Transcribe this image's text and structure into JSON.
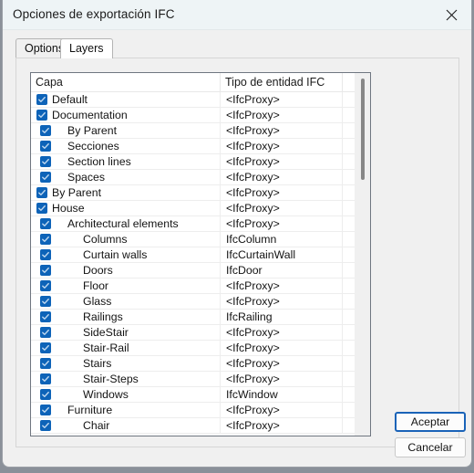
{
  "window": {
    "title": "Opciones de exportación IFC",
    "close_icon": "close-icon"
  },
  "tabs": [
    {
      "id": "options",
      "label": "Options",
      "active": false
    },
    {
      "id": "layers",
      "label": "Layers",
      "active": true
    }
  ],
  "grid": {
    "columns": [
      "Capa",
      "Tipo de entidad IFC",
      ""
    ],
    "rows": [
      {
        "name": "Default",
        "type": "<IfcProxy>",
        "level": 0,
        "checked": true
      },
      {
        "name": "Documentation",
        "type": "<IfcProxy>",
        "level": 0,
        "checked": true
      },
      {
        "name": "By Parent",
        "type": "<IfcProxy>",
        "level": 1,
        "checked": true
      },
      {
        "name": "Secciones",
        "type": "<IfcProxy>",
        "level": 1,
        "checked": true
      },
      {
        "name": "Section lines",
        "type": "<IfcProxy>",
        "level": 1,
        "checked": true
      },
      {
        "name": "Spaces",
        "type": "<IfcProxy>",
        "level": 1,
        "checked": true
      },
      {
        "name": "By Parent",
        "type": "<IfcProxy>",
        "level": 0,
        "checked": true
      },
      {
        "name": "House",
        "type": "<IfcProxy>",
        "level": 0,
        "checked": true
      },
      {
        "name": "Architectural elements",
        "type": "<IfcProxy>",
        "level": 1,
        "checked": true
      },
      {
        "name": "Columns",
        "type": "IfcColumn",
        "level": 2,
        "checked": true
      },
      {
        "name": "Curtain walls",
        "type": "IfcCurtainWall",
        "level": 2,
        "checked": true
      },
      {
        "name": "Doors",
        "type": "IfcDoor",
        "level": 2,
        "checked": true
      },
      {
        "name": "Floor",
        "type": "<IfcProxy>",
        "level": 2,
        "checked": true
      },
      {
        "name": "Glass",
        "type": "<IfcProxy>",
        "level": 2,
        "checked": true
      },
      {
        "name": "Railings",
        "type": "IfcRailing",
        "level": 2,
        "checked": true
      },
      {
        "name": "SideStair",
        "type": "<IfcProxy>",
        "level": 2,
        "checked": true
      },
      {
        "name": "Stair-Rail",
        "type": "<IfcProxy>",
        "level": 2,
        "checked": true
      },
      {
        "name": "Stairs",
        "type": "<IfcProxy>",
        "level": 2,
        "checked": true
      },
      {
        "name": "Stair-Steps",
        "type": "<IfcProxy>",
        "level": 2,
        "checked": true
      },
      {
        "name": "Windows",
        "type": "IfcWindow",
        "level": 2,
        "checked": true
      },
      {
        "name": "Furniture",
        "type": "<IfcProxy>",
        "level": 1,
        "checked": true
      },
      {
        "name": "Chair",
        "type": "<IfcProxy>",
        "level": 2,
        "checked": true
      }
    ]
  },
  "buttons": {
    "accept": "Aceptar",
    "cancel": "Cancelar"
  },
  "colors": {
    "checkbox_fill": "#0d63b8",
    "titlebar": "#eef4f6",
    "accept_focus_border": "#1a63b8",
    "scrollbar_thumb": "#878787"
  }
}
